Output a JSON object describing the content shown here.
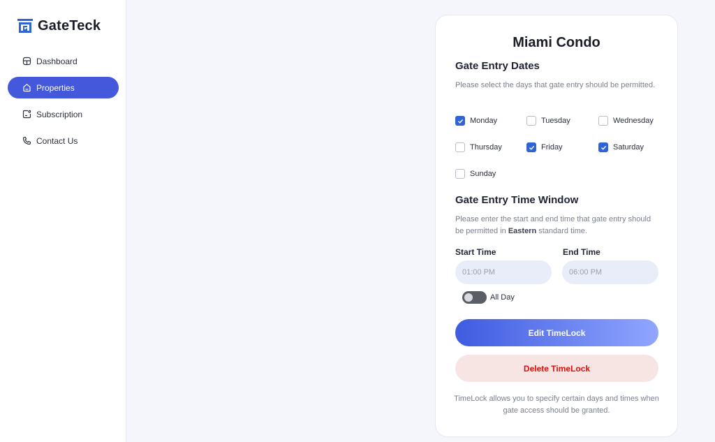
{
  "app": {
    "name": "GateTeck",
    "brand_color": "#2f63d6",
    "accent_color": "#4458dc"
  },
  "sidebar": {
    "items": [
      {
        "label": "Dashboard",
        "icon": "dashboard-icon",
        "active": false
      },
      {
        "label": "Properties",
        "icon": "home-icon",
        "active": true
      },
      {
        "label": "Subscription",
        "icon": "subscription-icon",
        "active": false
      },
      {
        "label": "Contact Us",
        "icon": "phone-icon",
        "active": false
      }
    ]
  },
  "card": {
    "title": "Miami Condo",
    "dates": {
      "heading": "Gate Entry Dates",
      "description": "Please select the days that gate entry should be permitted.",
      "days": [
        {
          "label": "Monday",
          "checked": true
        },
        {
          "label": "Tuesday",
          "checked": false
        },
        {
          "label": "Wednesday",
          "checked": false
        },
        {
          "label": "Thursday",
          "checked": false
        },
        {
          "label": "Friday",
          "checked": true
        },
        {
          "label": "Saturday",
          "checked": true
        },
        {
          "label": "Sunday",
          "checked": false
        }
      ]
    },
    "time_window": {
      "heading": "Gate Entry Time Window",
      "description_prefix": "Please enter the start and end time that gate entry should be permitted in ",
      "description_emphasis": "Eastern",
      "description_suffix": " standard time.",
      "start_label": "Start Time",
      "start_placeholder": "01:00 PM",
      "end_label": "End Time",
      "end_placeholder": "06:00 PM",
      "all_day_label": "All Day",
      "all_day_on": false
    },
    "edit_button": "Edit TimeLock",
    "delete_button": "Delete TimeLock",
    "footnote": "TimeLock allows you to specify certain days and times when gate access should be granted."
  }
}
